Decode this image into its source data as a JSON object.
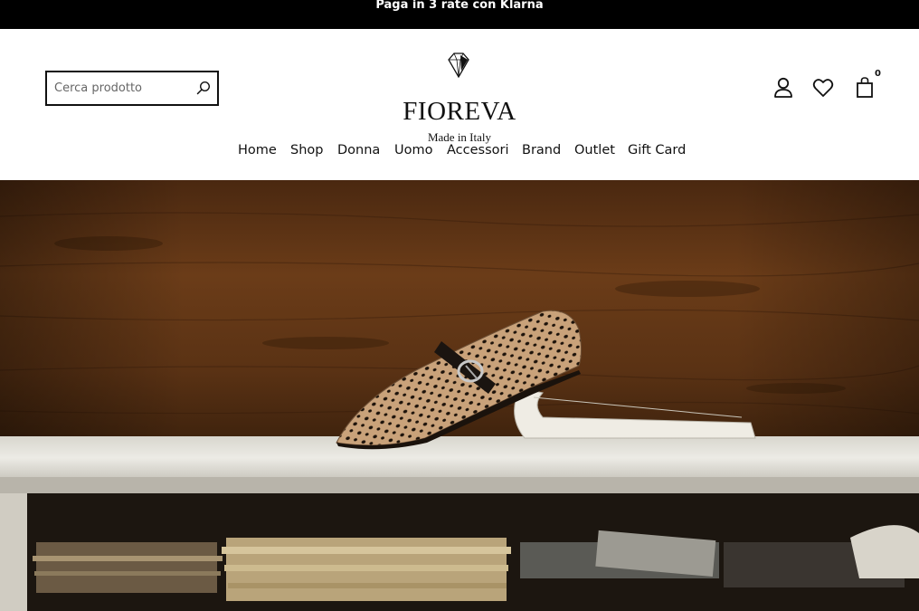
{
  "announcement": "Paga in 3 rate con Klarna",
  "search": {
    "placeholder": "Cerca prodotto",
    "icon": "search-icon"
  },
  "logo": {
    "brand": "FIOREVA",
    "tagline": "Made in Italy"
  },
  "header_icons": {
    "account": "user-icon",
    "wishlist": "heart-icon",
    "cart": "shopping-bag-icon",
    "cart_count": "0"
  },
  "nav": {
    "items": [
      "Home",
      "Shop",
      "Donna",
      "Uomo",
      "Accessori",
      "Brand",
      "Outlet",
      "Gift Card"
    ]
  },
  "colors": {
    "topbar": "#000000",
    "text": "#111111",
    "wood": "#5a3214",
    "shelf": "#e8e6df"
  }
}
